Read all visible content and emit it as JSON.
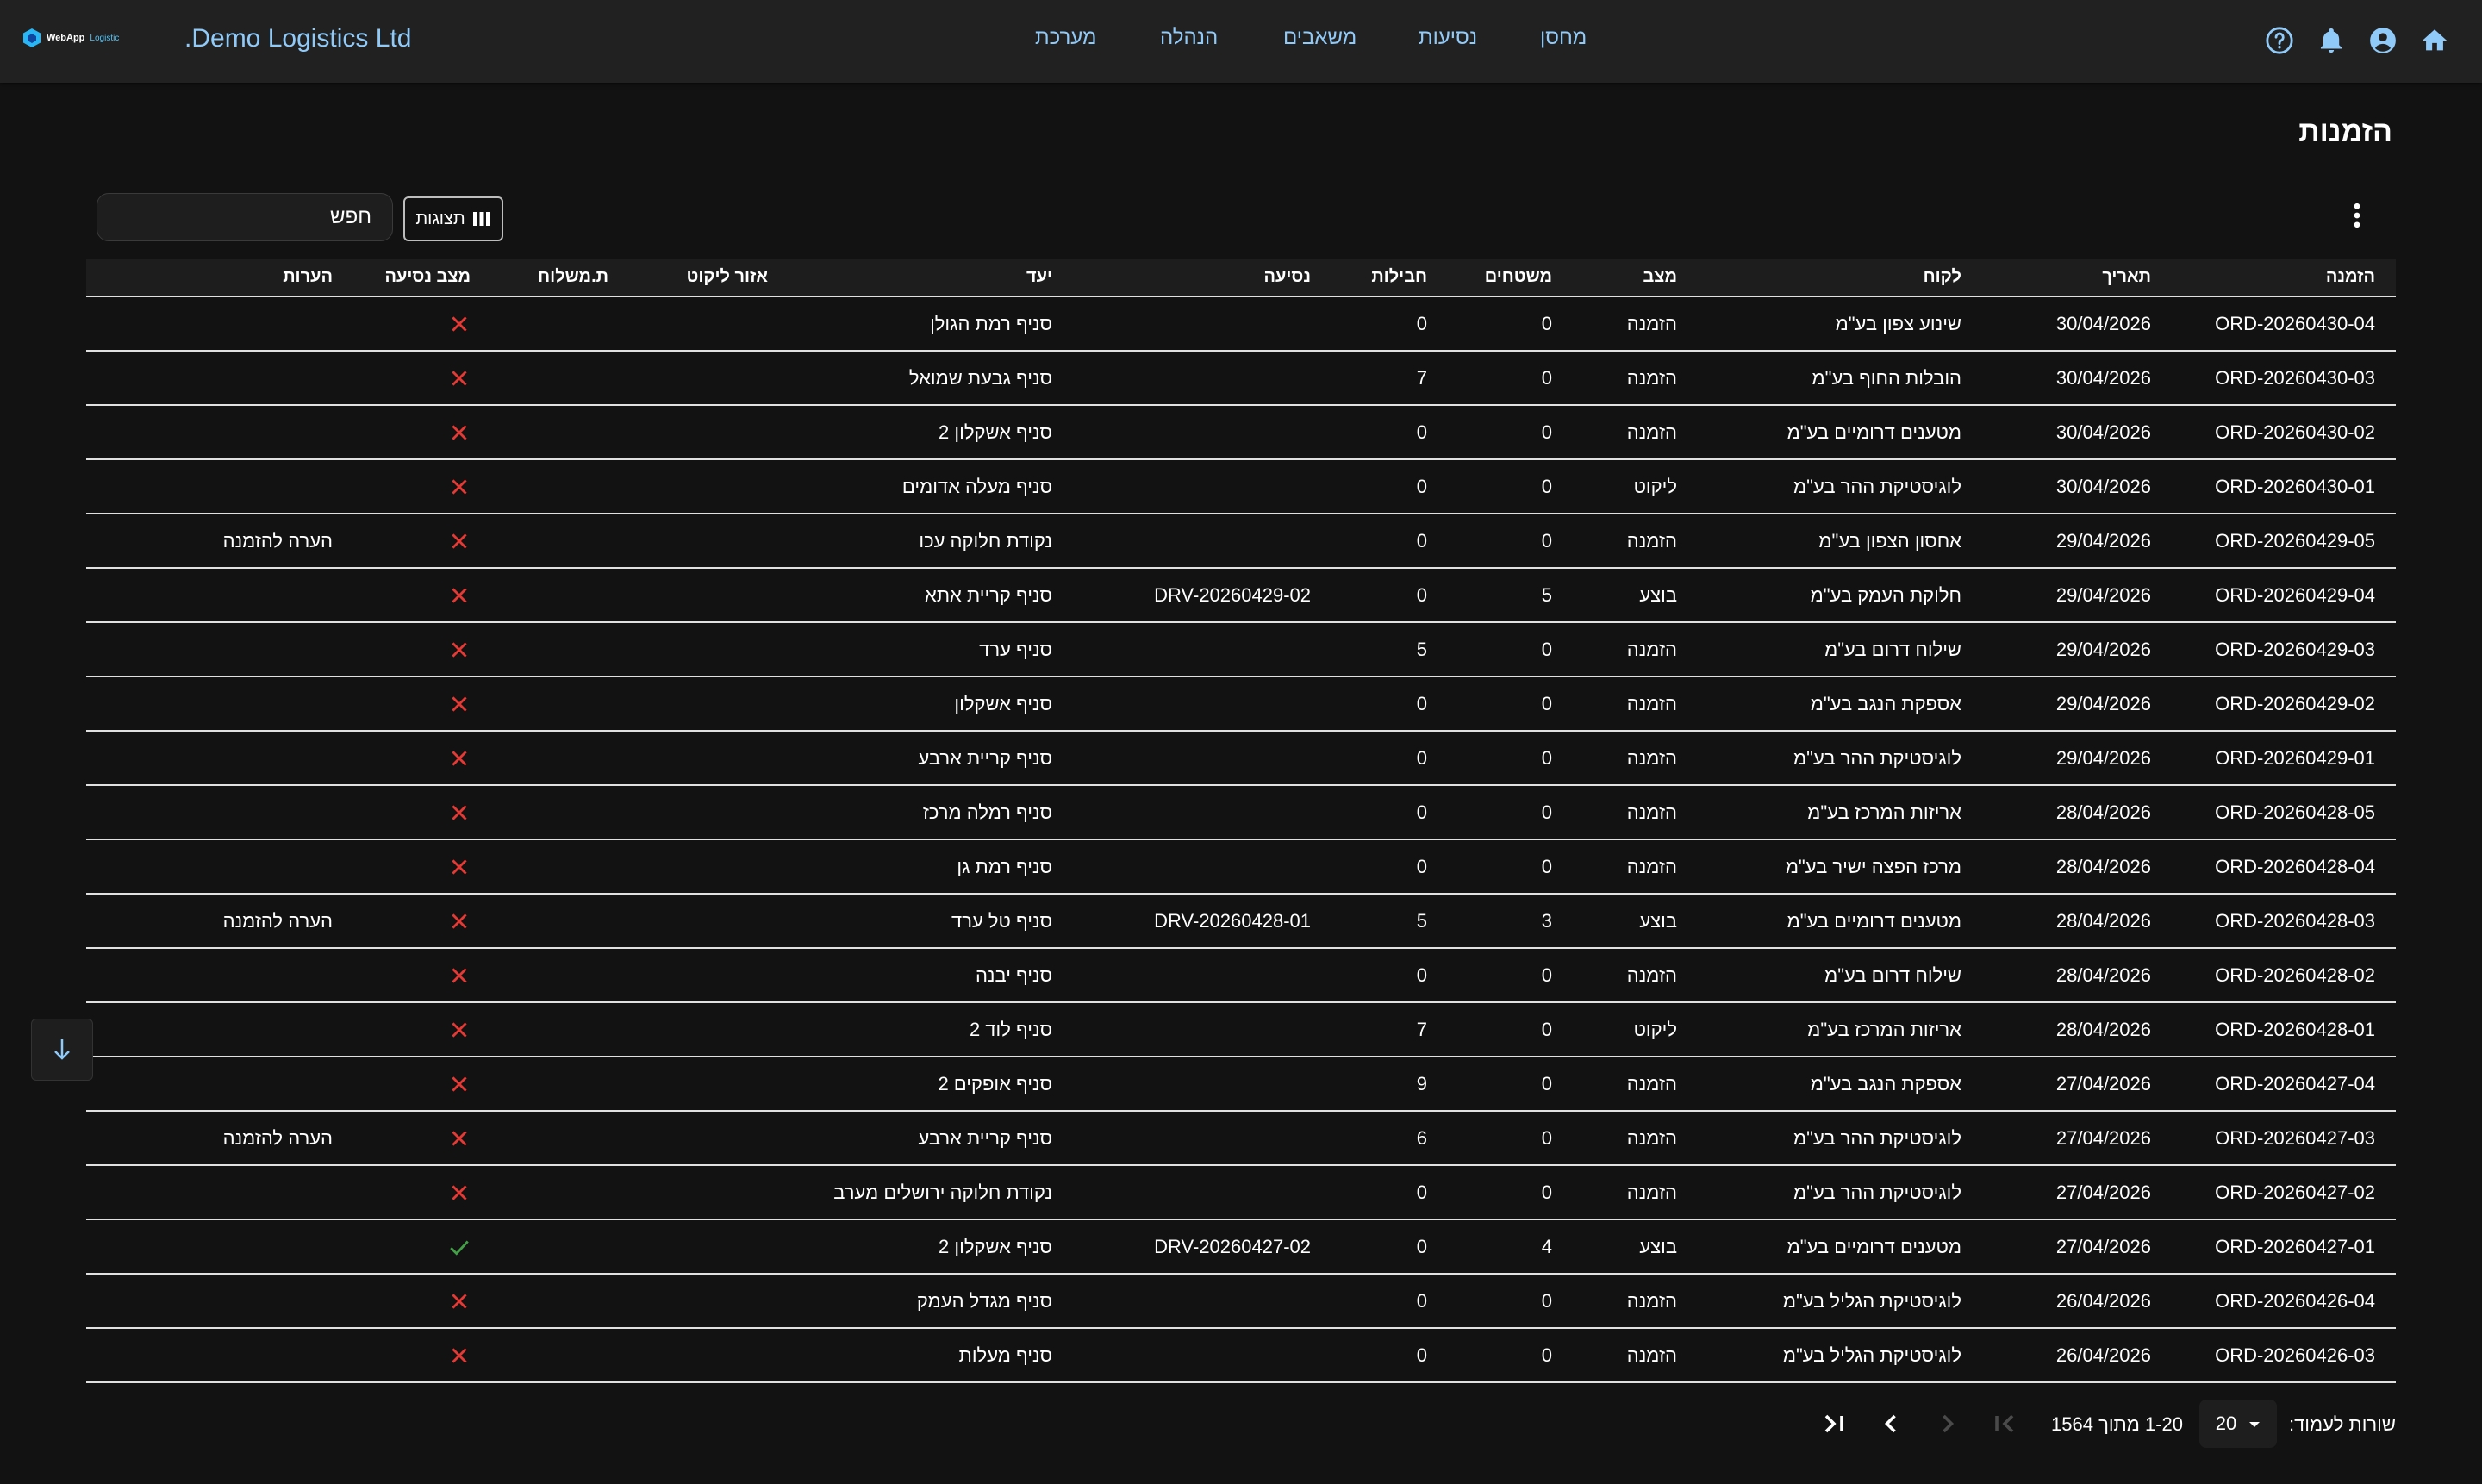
{
  "header": {
    "brand_text": "WebApp",
    "brand_sub": "Logistic",
    "company": "Demo Logistics Ltd.",
    "nav": [
      "מערכת",
      "הנהלה",
      "משאבים",
      "נסיעות",
      "מחסן"
    ],
    "icons": [
      "help-icon",
      "bell-icon",
      "account-icon",
      "home-icon"
    ]
  },
  "page": {
    "title": "הזמנות",
    "search_placeholder": "חפש",
    "views_label": "תצוגות"
  },
  "table": {
    "columns": [
      "הזמנה",
      "תאריך",
      "לקוח",
      "מצב",
      "משטחים",
      "חבילות",
      "נסיעה",
      "יעד",
      "אזור ליקוט",
      "ת.משלוח",
      "מצב נסיעה",
      "הערות"
    ],
    "rows": [
      {
        "order": "ORD-20260430-04",
        "date": "30/04/2026",
        "customer": "שינוע צפון בע\"מ",
        "status": "הזמנה",
        "pallets": "0",
        "packages": "0",
        "trip": "",
        "dest": "סניף רמת הגולן",
        "zone": "",
        "ship": "",
        "trip_ok": false,
        "notes": ""
      },
      {
        "order": "ORD-20260430-03",
        "date": "30/04/2026",
        "customer": "הובלות החוף בע\"מ",
        "status": "הזמנה",
        "pallets": "0",
        "packages": "7",
        "trip": "",
        "dest": "סניף גבעת שמואל",
        "zone": "",
        "ship": "",
        "trip_ok": false,
        "notes": ""
      },
      {
        "order": "ORD-20260430-02",
        "date": "30/04/2026",
        "customer": "מטענים דרומיים בע\"מ",
        "status": "הזמנה",
        "pallets": "0",
        "packages": "0",
        "trip": "",
        "dest": "סניף אשקלון 2",
        "zone": "",
        "ship": "",
        "trip_ok": false,
        "notes": ""
      },
      {
        "order": "ORD-20260430-01",
        "date": "30/04/2026",
        "customer": "לוגיסטיקת ההר בע\"מ",
        "status": "ליקוט",
        "pallets": "0",
        "packages": "0",
        "trip": "",
        "dest": "סניף מעלה אדומים",
        "zone": "",
        "ship": "",
        "trip_ok": false,
        "notes": ""
      },
      {
        "order": "ORD-20260429-05",
        "date": "29/04/2026",
        "customer": "אחסון הצפון בע\"מ",
        "status": "הזמנה",
        "pallets": "0",
        "packages": "0",
        "trip": "",
        "dest": "נקודת חלוקה עכו",
        "zone": "",
        "ship": "",
        "trip_ok": false,
        "notes": "הערה להזמנה"
      },
      {
        "order": "ORD-20260429-04",
        "date": "29/04/2026",
        "customer": "חלוקת העמק בע\"מ",
        "status": "בוצע",
        "pallets": "5",
        "packages": "0",
        "trip": "DRV-20260429-02",
        "dest": "סניף קריית אתא",
        "zone": "",
        "ship": "",
        "trip_ok": false,
        "notes": ""
      },
      {
        "order": "ORD-20260429-03",
        "date": "29/04/2026",
        "customer": "שילוח דרום בע\"מ",
        "status": "הזמנה",
        "pallets": "0",
        "packages": "5",
        "trip": "",
        "dest": "סניף ערד",
        "zone": "",
        "ship": "",
        "trip_ok": false,
        "notes": ""
      },
      {
        "order": "ORD-20260429-02",
        "date": "29/04/2026",
        "customer": "אספקת הנגב בע\"מ",
        "status": "הזמנה",
        "pallets": "0",
        "packages": "0",
        "trip": "",
        "dest": "סניף אשקלון",
        "zone": "",
        "ship": "",
        "trip_ok": false,
        "notes": ""
      },
      {
        "order": "ORD-20260429-01",
        "date": "29/04/2026",
        "customer": "לוגיסטיקת ההר בע\"מ",
        "status": "הזמנה",
        "pallets": "0",
        "packages": "0",
        "trip": "",
        "dest": "סניף קריית ארבע",
        "zone": "",
        "ship": "",
        "trip_ok": false,
        "notes": ""
      },
      {
        "order": "ORD-20260428-05",
        "date": "28/04/2026",
        "customer": "אריזות המרכז בע\"מ",
        "status": "הזמנה",
        "pallets": "0",
        "packages": "0",
        "trip": "",
        "dest": "סניף רמלה מרכז",
        "zone": "",
        "ship": "",
        "trip_ok": false,
        "notes": ""
      },
      {
        "order": "ORD-20260428-04",
        "date": "28/04/2026",
        "customer": "מרכז הפצה ישיר בע\"מ",
        "status": "הזמנה",
        "pallets": "0",
        "packages": "0",
        "trip": "",
        "dest": "סניף רמת גן",
        "zone": "",
        "ship": "",
        "trip_ok": false,
        "notes": ""
      },
      {
        "order": "ORD-20260428-03",
        "date": "28/04/2026",
        "customer": "מטענים דרומיים בע\"מ",
        "status": "בוצע",
        "pallets": "3",
        "packages": "5",
        "trip": "DRV-20260428-01",
        "dest": "סניף טל ערד",
        "zone": "",
        "ship": "",
        "trip_ok": false,
        "notes": "הערה להזמנה"
      },
      {
        "order": "ORD-20260428-02",
        "date": "28/04/2026",
        "customer": "שילוח דרום בע\"מ",
        "status": "הזמנה",
        "pallets": "0",
        "packages": "0",
        "trip": "",
        "dest": "סניף יבנה",
        "zone": "",
        "ship": "",
        "trip_ok": false,
        "notes": ""
      },
      {
        "order": "ORD-20260428-01",
        "date": "28/04/2026",
        "customer": "אריזות המרכז בע\"מ",
        "status": "ליקוט",
        "pallets": "0",
        "packages": "7",
        "trip": "",
        "dest": "סניף לוד 2",
        "zone": "",
        "ship": "",
        "trip_ok": false,
        "notes": ""
      },
      {
        "order": "ORD-20260427-04",
        "date": "27/04/2026",
        "customer": "אספקת הנגב בע\"מ",
        "status": "הזמנה",
        "pallets": "0",
        "packages": "9",
        "trip": "",
        "dest": "סניף אופקים 2",
        "zone": "",
        "ship": "",
        "trip_ok": false,
        "notes": ""
      },
      {
        "order": "ORD-20260427-03",
        "date": "27/04/2026",
        "customer": "לוגיסטיקת ההר בע\"מ",
        "status": "הזמנה",
        "pallets": "0",
        "packages": "6",
        "trip": "",
        "dest": "סניף קריית ארבע",
        "zone": "",
        "ship": "",
        "trip_ok": false,
        "notes": "הערה להזמנה"
      },
      {
        "order": "ORD-20260427-02",
        "date": "27/04/2026",
        "customer": "לוגיסטיקת ההר בע\"מ",
        "status": "הזמנה",
        "pallets": "0",
        "packages": "0",
        "trip": "",
        "dest": "נקודת חלוקה ירושלים מערב",
        "zone": "",
        "ship": "",
        "trip_ok": false,
        "notes": ""
      },
      {
        "order": "ORD-20260427-01",
        "date": "27/04/2026",
        "customer": "מטענים דרומיים בע\"מ",
        "status": "בוצע",
        "pallets": "4",
        "packages": "0",
        "trip": "DRV-20260427-02",
        "dest": "סניף אשקלון 2",
        "zone": "",
        "ship": "",
        "trip_ok": true,
        "notes": ""
      },
      {
        "order": "ORD-20260426-04",
        "date": "26/04/2026",
        "customer": "לוגיסטיקת הגליל בע\"מ",
        "status": "הזמנה",
        "pallets": "0",
        "packages": "0",
        "trip": "",
        "dest": "סניף מגדל העמק",
        "zone": "",
        "ship": "",
        "trip_ok": false,
        "notes": ""
      },
      {
        "order": "ORD-20260426-03",
        "date": "26/04/2026",
        "customer": "לוגיסטיקת הגליל בע\"מ",
        "status": "הזמנה",
        "pallets": "0",
        "packages": "0",
        "trip": "",
        "dest": "סניף מעלות",
        "zone": "",
        "ship": "",
        "trip_ok": false,
        "notes": ""
      }
    ]
  },
  "pagination": {
    "rows_label": "שורות לעמוד:",
    "rows_value": "20",
    "range": "1-20 מתוך 1564"
  },
  "colors": {
    "accent": "#90caf9",
    "cross": "#e53935",
    "check": "#43a047"
  }
}
